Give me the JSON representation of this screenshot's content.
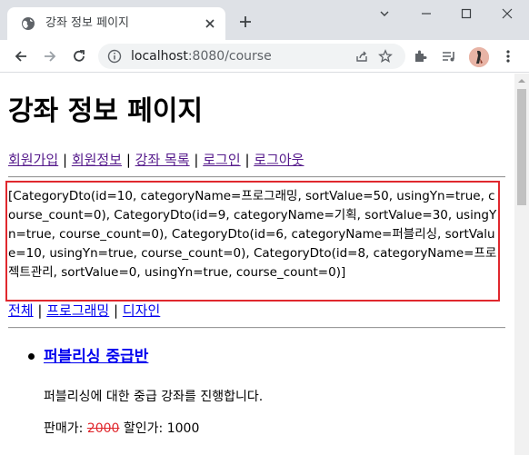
{
  "browser": {
    "tab_title": "강좌 정보 페이지",
    "url_host": "localhost",
    "url_rest": ":8080/course",
    "icons": [
      "globe-icon",
      "close-icon",
      "plus-icon",
      "chevron-down-icon",
      "minimize-icon",
      "maximize-icon",
      "window-close-icon",
      "back-icon",
      "forward-icon",
      "reload-icon",
      "info-icon",
      "share-icon",
      "star-icon",
      "extensions-icon",
      "media-queue-icon",
      "profile-avatar",
      "menu-icon"
    ]
  },
  "page": {
    "title": "강좌 정보 페이지",
    "nav": [
      {
        "label": "회원가입"
      },
      {
        "label": "회원정보"
      },
      {
        "label": "강좌 목록"
      },
      {
        "label": "로그인"
      },
      {
        "label": "로그아웃"
      }
    ],
    "nav_separator": "|",
    "categories_raw": "[CategoryDto(id=10, categoryName=프로그래밍, sortValue=50, usingYn=true, course_count=0), CategoryDto(id=9, categoryName=기획, sortValue=30, usingYn=true, course_count=0), CategoryDto(id=6, categoryName=퍼블리싱, sortValue=10, usingYn=true, course_count=0), CategoryDto(id=8, categoryName=프로젝트관리, sortValue=0, usingYn=true, course_count=0)]",
    "category_links": [
      {
        "label": "전체"
      },
      {
        "label": "프로그래밍"
      },
      {
        "label": "디자인"
      }
    ],
    "course": {
      "title": "퍼블리싱 중급반",
      "description": "퍼블리싱에 대한 중급 강좌를 진행합니다.",
      "price_label": "판매가:",
      "price": "2000",
      "sale_label": "할인가:",
      "sale_price": "1000"
    }
  },
  "colors": {
    "highlight_border": "#e0282e",
    "visited_link": "#551a8b",
    "link": "#0000ee"
  }
}
